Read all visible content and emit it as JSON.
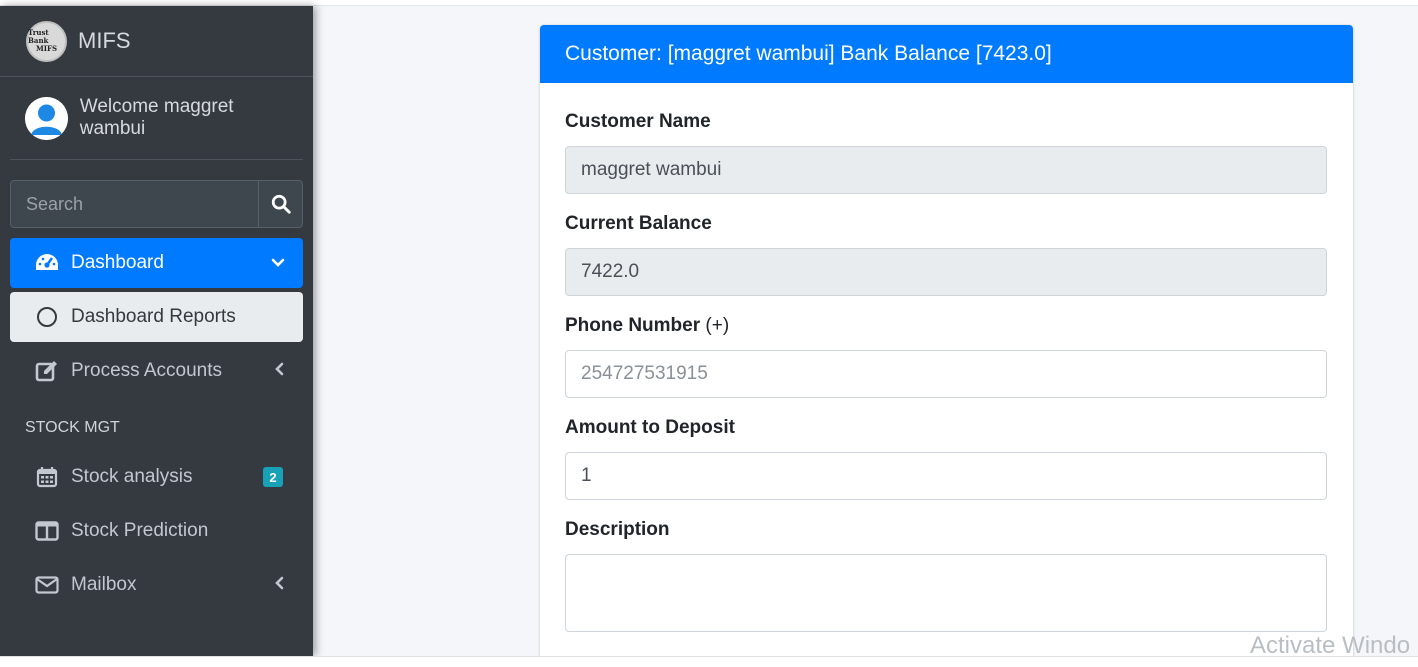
{
  "brand": {
    "logo_text_line1": "Trust Bank",
    "logo_text_line2": "MIFS",
    "name": "MIFS"
  },
  "user": {
    "welcome": "Welcome maggret wambui"
  },
  "search": {
    "placeholder": "Search"
  },
  "nav": {
    "dashboard": "Dashboard",
    "dashboard_reports": "Dashboard Reports",
    "process_accounts": "Process Accounts",
    "section_stock": "STOCK MGT",
    "stock_analysis": "Stock analysis",
    "stock_analysis_badge": "2",
    "stock_prediction": "Stock Prediction",
    "mailbox": "Mailbox"
  },
  "card": {
    "header": "Customer: [maggret wambui] Bank Balance [7423.0]"
  },
  "form": {
    "customer_name_label": "Customer Name",
    "customer_name_value": "maggret wambui",
    "current_balance_label": "Current Balance",
    "current_balance_value": "7422.0",
    "phone_label": "Phone Number",
    "phone_hint": "(+)",
    "phone_placeholder": "254727531915",
    "amount_label": "Amount to Deposit",
    "amount_value": "1",
    "description_label": "Description",
    "description_value": ""
  },
  "watermark": "Activate Windo",
  "colors": {
    "sidebar_bg": "#343a40",
    "primary": "#007bff",
    "badge": "#17a2b8",
    "content_bg": "#f4f6f9"
  }
}
